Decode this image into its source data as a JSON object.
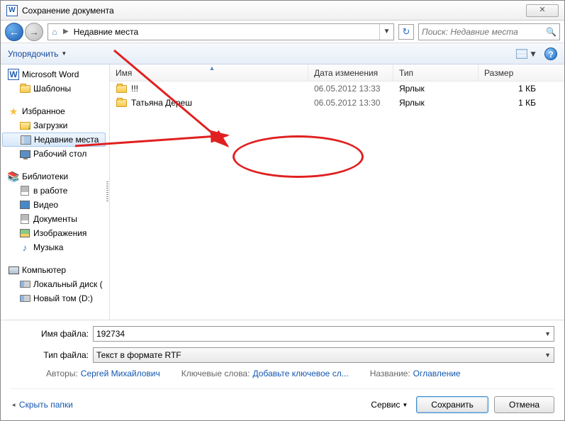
{
  "title": "Сохранение документа",
  "nav": {
    "crumb": "Недавние места"
  },
  "search": {
    "placeholder": "Поиск: Недавние места"
  },
  "toolbar": {
    "organize": "Упорядочить"
  },
  "tree": {
    "word": "Microsoft Word",
    "templates": "Шаблоны",
    "favorites": "Избранное",
    "downloads": "Загрузки",
    "recent": "Недавние места",
    "desktop": "Рабочий стол",
    "libraries": "Библиотеки",
    "inwork": "в работе",
    "video": "Видео",
    "documents": "Документы",
    "images": "Изображения",
    "music": "Музыка",
    "computer": "Компьютер",
    "localdisk": "Локальный диск (",
    "newvol": "Новый том (D:)"
  },
  "columns": {
    "name": "Имя",
    "date": "Дата изменения",
    "type": "Тип",
    "size": "Размер"
  },
  "files": [
    {
      "name": "!!!",
      "date": "06.05.2012 13:33",
      "type": "Ярлык",
      "size": "1 КБ"
    },
    {
      "name": "Татьяна Дереш",
      "date": "06.05.2012 13:30",
      "type": "Ярлык",
      "size": "1 КБ"
    }
  ],
  "form": {
    "filename_label": "Имя файла:",
    "filename_value": "192734",
    "filetype_label": "Тип файла:",
    "filetype_value": "Текст в формате RTF",
    "authors_label": "Авторы:",
    "authors_value": "Сергей Михайлович",
    "keywords_label": "Ключевые слова:",
    "keywords_value": "Добавьте ключевое сл...",
    "title_label": "Название:",
    "title_value": "Оглавление"
  },
  "footer": {
    "hide": "Скрыть папки",
    "tools": "Сервис",
    "save": "Сохранить",
    "cancel": "Отмена"
  }
}
